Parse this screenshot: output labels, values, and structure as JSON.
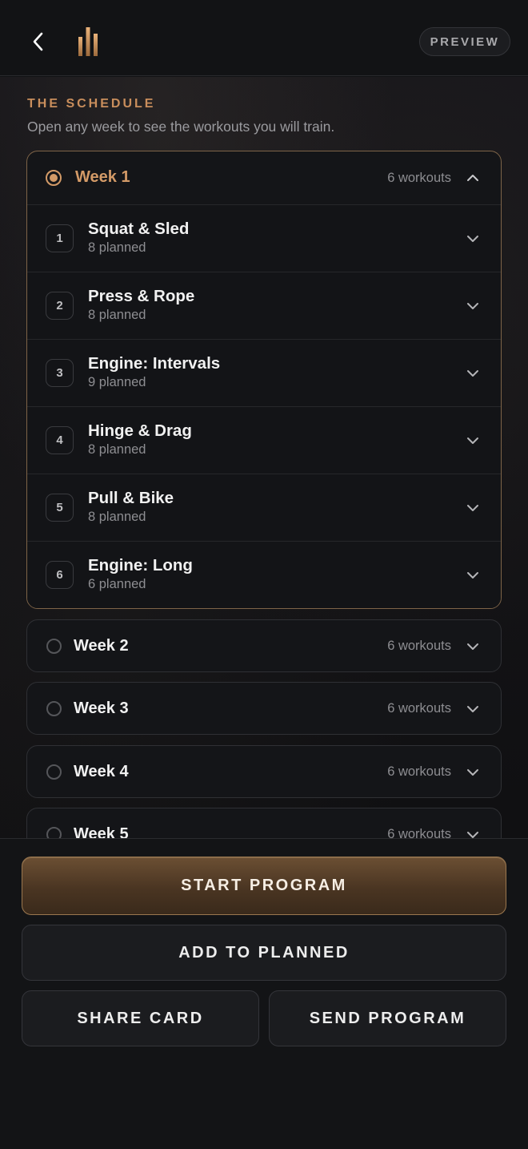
{
  "header": {
    "back_icon": "chevron-left-icon",
    "logo_icon": "bars-logo-icon",
    "preview_label": "PREVIEW"
  },
  "schedule": {
    "title": "THE SCHEDULE",
    "subtitle": "Open any week to see the workouts you will train."
  },
  "weeks": [
    {
      "name": "Week 1",
      "count": "6 workouts",
      "expanded": true,
      "workouts": [
        {
          "number": "1",
          "title": "Squat & Sled",
          "planned": "8 planned"
        },
        {
          "number": "2",
          "title": "Press & Rope",
          "planned": "8 planned"
        },
        {
          "number": "3",
          "title": "Engine: Intervals",
          "planned": "9 planned"
        },
        {
          "number": "4",
          "title": "Hinge & Drag",
          "planned": "8 planned"
        },
        {
          "number": "5",
          "title": "Pull & Bike",
          "planned": "8 planned"
        },
        {
          "number": "6",
          "title": "Engine: Long",
          "planned": "6 planned"
        }
      ]
    },
    {
      "name": "Week 2",
      "count": "6 workouts",
      "expanded": false
    },
    {
      "name": "Week 3",
      "count": "6 workouts",
      "expanded": false
    },
    {
      "name": "Week 4",
      "count": "6 workouts",
      "expanded": false
    },
    {
      "name": "Week 5",
      "count": "6 workouts",
      "expanded": false
    }
  ],
  "actions": {
    "start": "START PROGRAM",
    "add": "ADD TO PLANNED",
    "share": "SHARE CARD",
    "send": "SEND PROGRAM"
  },
  "colors": {
    "accent": "#D39A67",
    "background": "#101113",
    "primary_button": "#4A3522"
  }
}
